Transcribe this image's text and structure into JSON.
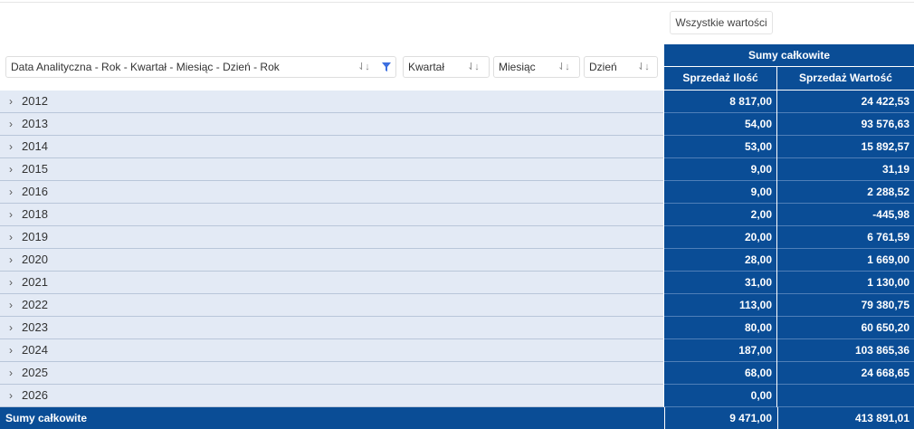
{
  "toolbar": {
    "all_values_label": "Wszystkie wartości"
  },
  "row_fields": [
    {
      "label": "Data Analityczna - Rok - Kwartał - Miesiąc - Dzień - Rok",
      "sort_icon": "sort-icon",
      "filter_icon": "filter-icon",
      "filter_color": "#3d6fe0"
    },
    {
      "label": "Kwartał",
      "sort_icon": "sort-icon"
    },
    {
      "label": "Miesiąc",
      "sort_icon": "sort-icon"
    },
    {
      "label": "Dzień",
      "sort_icon": "sort-icon"
    }
  ],
  "header": {
    "group_label": "Sumy całkowite",
    "columns": [
      "Sprzedaż Ilość",
      "Sprzedaż Wartość"
    ]
  },
  "rows": [
    {
      "label": "2012",
      "qty": "8 817,00",
      "value": "24 422,53"
    },
    {
      "label": "2013",
      "qty": "54,00",
      "value": "93 576,63"
    },
    {
      "label": "2014",
      "qty": "53,00",
      "value": "15 892,57"
    },
    {
      "label": "2015",
      "qty": "9,00",
      "value": "31,19"
    },
    {
      "label": "2016",
      "qty": "9,00",
      "value": "2 288,52"
    },
    {
      "label": "2018",
      "qty": "2,00",
      "value": "-445,98"
    },
    {
      "label": "2019",
      "qty": "20,00",
      "value": "6 761,59"
    },
    {
      "label": "2020",
      "qty": "28,00",
      "value": "1 669,00"
    },
    {
      "label": "2021",
      "qty": "31,00",
      "value": "1 130,00"
    },
    {
      "label": "2022",
      "qty": "113,00",
      "value": "79 380,75"
    },
    {
      "label": "2023",
      "qty": "80,00",
      "value": "60 650,20"
    },
    {
      "label": "2024",
      "qty": "187,00",
      "value": "103 865,36"
    },
    {
      "label": "2025",
      "qty": "68,00",
      "value": "24 668,65"
    },
    {
      "label": "2026",
      "qty": "0,00",
      "value": ""
    }
  ],
  "totals": {
    "label": "Sumy całkowite",
    "qty": "9 471,00",
    "value": "413 891,01"
  },
  "colors": {
    "header_bg": "#0a4d96",
    "row_bg": "#e3eaf5",
    "row_border": "#b9c6d9"
  }
}
